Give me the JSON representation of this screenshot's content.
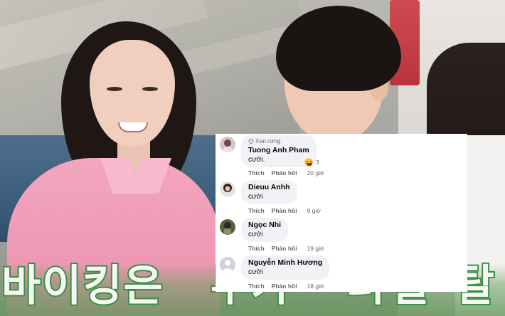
{
  "video": {
    "subtitle_parts": [
      "바이킹은",
      "무가",
      "더",
      "칠",
      "탈"
    ]
  },
  "comments": [
    {
      "badge": "Fan cứng",
      "author": "Tuong Anh Pham",
      "text": "cười.",
      "reaction_count": "3",
      "like_label": "Thích",
      "reply_label": "Phản hồi",
      "time": "20 giờ",
      "avatar_color": "#c9a6b4"
    },
    {
      "author": "Dieuu Anhh",
      "text": "cười",
      "like_label": "Thích",
      "reply_label": "Phản hồi",
      "time": "9 giờ",
      "avatar_color": "#3b2f2c"
    },
    {
      "author": "Ngọc Nhi",
      "text": "cười",
      "like_label": "Thích",
      "reply_label": "Phản hồi",
      "time": "19 giờ",
      "avatar_color": "#4e5a3a"
    },
    {
      "author": "Nguyễn Minh Hương",
      "text": "cười",
      "like_label": "Thích",
      "reply_label": "Phản hồi",
      "time": "18 giờ",
      "avatar_color": "#cfd3d9"
    }
  ]
}
